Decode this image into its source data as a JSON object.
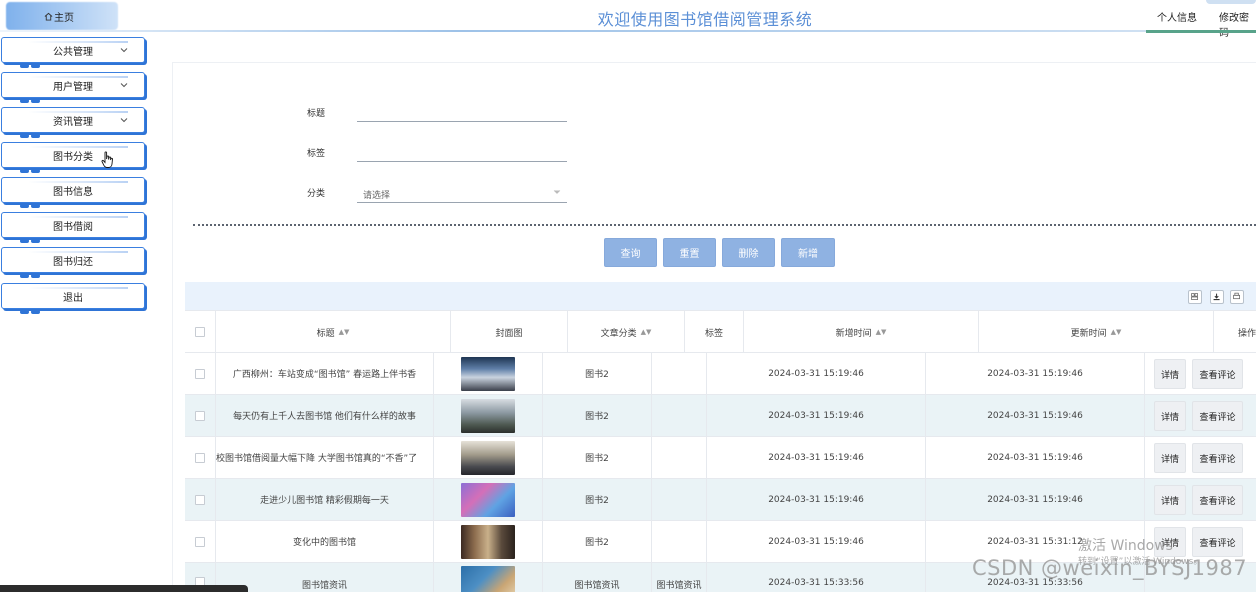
{
  "header": {
    "home_label": "主页",
    "title": "欢迎使用图书馆借阅管理系统",
    "profile_label": "个人信息",
    "change_password_label": "修改密码"
  },
  "sidebar": {
    "items": [
      {
        "label": "公共管理",
        "has_children": true
      },
      {
        "label": "用户管理",
        "has_children": true
      },
      {
        "label": "资讯管理",
        "has_children": true
      },
      {
        "label": "图书分类",
        "has_children": false
      },
      {
        "label": "图书信息",
        "has_children": false
      },
      {
        "label": "图书借阅",
        "has_children": false
      },
      {
        "label": "图书归还",
        "has_children": false
      },
      {
        "label": "退出",
        "has_children": false
      }
    ]
  },
  "search": {
    "title_label": "标题",
    "tag_label": "标签",
    "category_label": "分类",
    "category_placeholder": "请选择",
    "buttons": {
      "query": "查询",
      "reset": "重置",
      "delete": "删除",
      "add": "新增"
    }
  },
  "table": {
    "columns": {
      "title": "标题",
      "cover": "封面图",
      "category": "文章分类",
      "tag": "标签",
      "created": "新增时间",
      "updated": "更新时间",
      "actions": "操作"
    },
    "row_buttons": {
      "detail": "详情",
      "comments": "查看评论"
    },
    "rows": [
      {
        "title": "广西柳州：车站变成“图书馆” 春运路上伴书香",
        "category": "图书2",
        "tag": "",
        "created": "2024-03-31 15:19:46",
        "updated": "2024-03-31 15:19:46"
      },
      {
        "title": "每天仍有上千人去图书馆 他们有什么样的故事",
        "category": "图书2",
        "tag": "",
        "created": "2024-03-31 15:19:46",
        "updated": "2024-03-31 15:19:46"
      },
      {
        "title": "校图书馆借阅量大幅下降 大学图书馆真的“不香”了",
        "category": "图书2",
        "tag": "",
        "created": "2024-03-31 15:19:46",
        "updated": "2024-03-31 15:19:46"
      },
      {
        "title": "走进少儿图书馆 精彩假期每一天",
        "category": "图书2",
        "tag": "",
        "created": "2024-03-31 15:19:46",
        "updated": "2024-03-31 15:19:46"
      },
      {
        "title": "变化中的图书馆",
        "category": "图书2",
        "tag": "",
        "created": "2024-03-31 15:19:46",
        "updated": "2024-03-31 15:31:12"
      },
      {
        "title": "图书馆资讯",
        "category": "图书馆资讯",
        "tag": "图书馆资讯",
        "created": "2024-03-31 15:33:56",
        "updated": "2024-03-31 15:33:56"
      }
    ]
  },
  "overlays": {
    "activate_windows": "激活 Windows",
    "activate_windows_sub": "转到“设置”以激活 Windows。",
    "csdn_watermark": "CSDN @weixin_BYSJ1987"
  },
  "colors": {
    "accent": "#3a7fe0",
    "button": "#8fb2e2",
    "title": "#5b8fd6",
    "row_alt": "#eaf3f6"
  }
}
